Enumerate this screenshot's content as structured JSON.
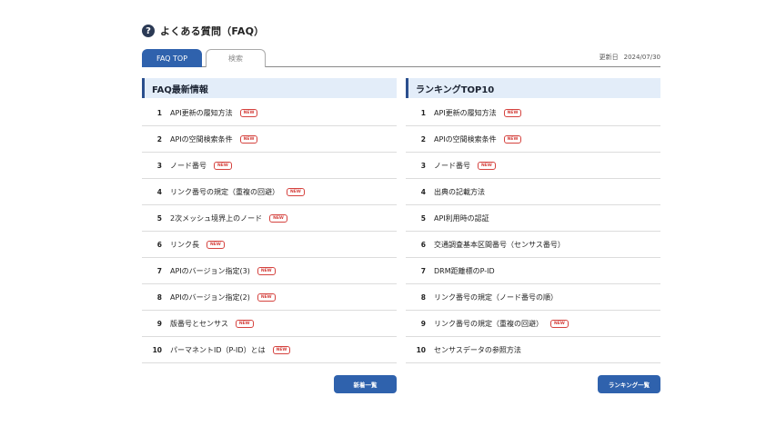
{
  "header": {
    "icon": "question-circle-icon",
    "title": "よくある質問（FAQ）"
  },
  "tabs": [
    {
      "label": "FAQ TOP",
      "active": true
    },
    {
      "label": "検索",
      "active": false
    }
  ],
  "update": {
    "label": "更新日",
    "date": "2024/07/30"
  },
  "latest": {
    "title": "FAQ最新情報",
    "items": [
      {
        "num": "1",
        "text": "API更新の履知方法",
        "badge": "NEW"
      },
      {
        "num": "2",
        "text": "APIの空間検索条件",
        "badge": "NEW"
      },
      {
        "num": "3",
        "text": "ノード番号",
        "badge": "NEW"
      },
      {
        "num": "4",
        "text": "リンク番号の規定（重複の回避）",
        "badge": "NEW"
      },
      {
        "num": "5",
        "text": "2次メッシュ境界上のノード",
        "badge": "NEW"
      },
      {
        "num": "6",
        "text": "リンク長",
        "badge": "NEW"
      },
      {
        "num": "7",
        "text": "APIのバージョン指定(3)",
        "badge": "NEW"
      },
      {
        "num": "8",
        "text": "APIのバージョン指定(2)",
        "badge": "NEW"
      },
      {
        "num": "9",
        "text": "版番号とセンサス",
        "badge": "NEW"
      },
      {
        "num": "10",
        "text": "パーマネントID（P-ID）とは",
        "badge": "NEW"
      }
    ],
    "button": "新着一覧"
  },
  "ranking": {
    "title": "ランキングTOP10",
    "items": [
      {
        "num": "1",
        "text": "API更新の履知方法",
        "badge": "NEW"
      },
      {
        "num": "2",
        "text": "APIの空間検索条件",
        "badge": "NEW"
      },
      {
        "num": "3",
        "text": "ノード番号",
        "badge": "NEW"
      },
      {
        "num": "4",
        "text": "出典の記載方法",
        "badge": ""
      },
      {
        "num": "5",
        "text": "API利用時の認証",
        "badge": ""
      },
      {
        "num": "6",
        "text": "交通調査基本区間番号（センサス番号）",
        "badge": ""
      },
      {
        "num": "7",
        "text": "DRM距離標のP-ID",
        "badge": ""
      },
      {
        "num": "8",
        "text": "リンク番号の規定（ノード番号の順）",
        "badge": ""
      },
      {
        "num": "9",
        "text": "リンク番号の規定（重複の回避）",
        "badge": "NEW"
      },
      {
        "num": "10",
        "text": "センサスデータの参照方法",
        "badge": ""
      }
    ],
    "button": "ランキング一覧"
  }
}
